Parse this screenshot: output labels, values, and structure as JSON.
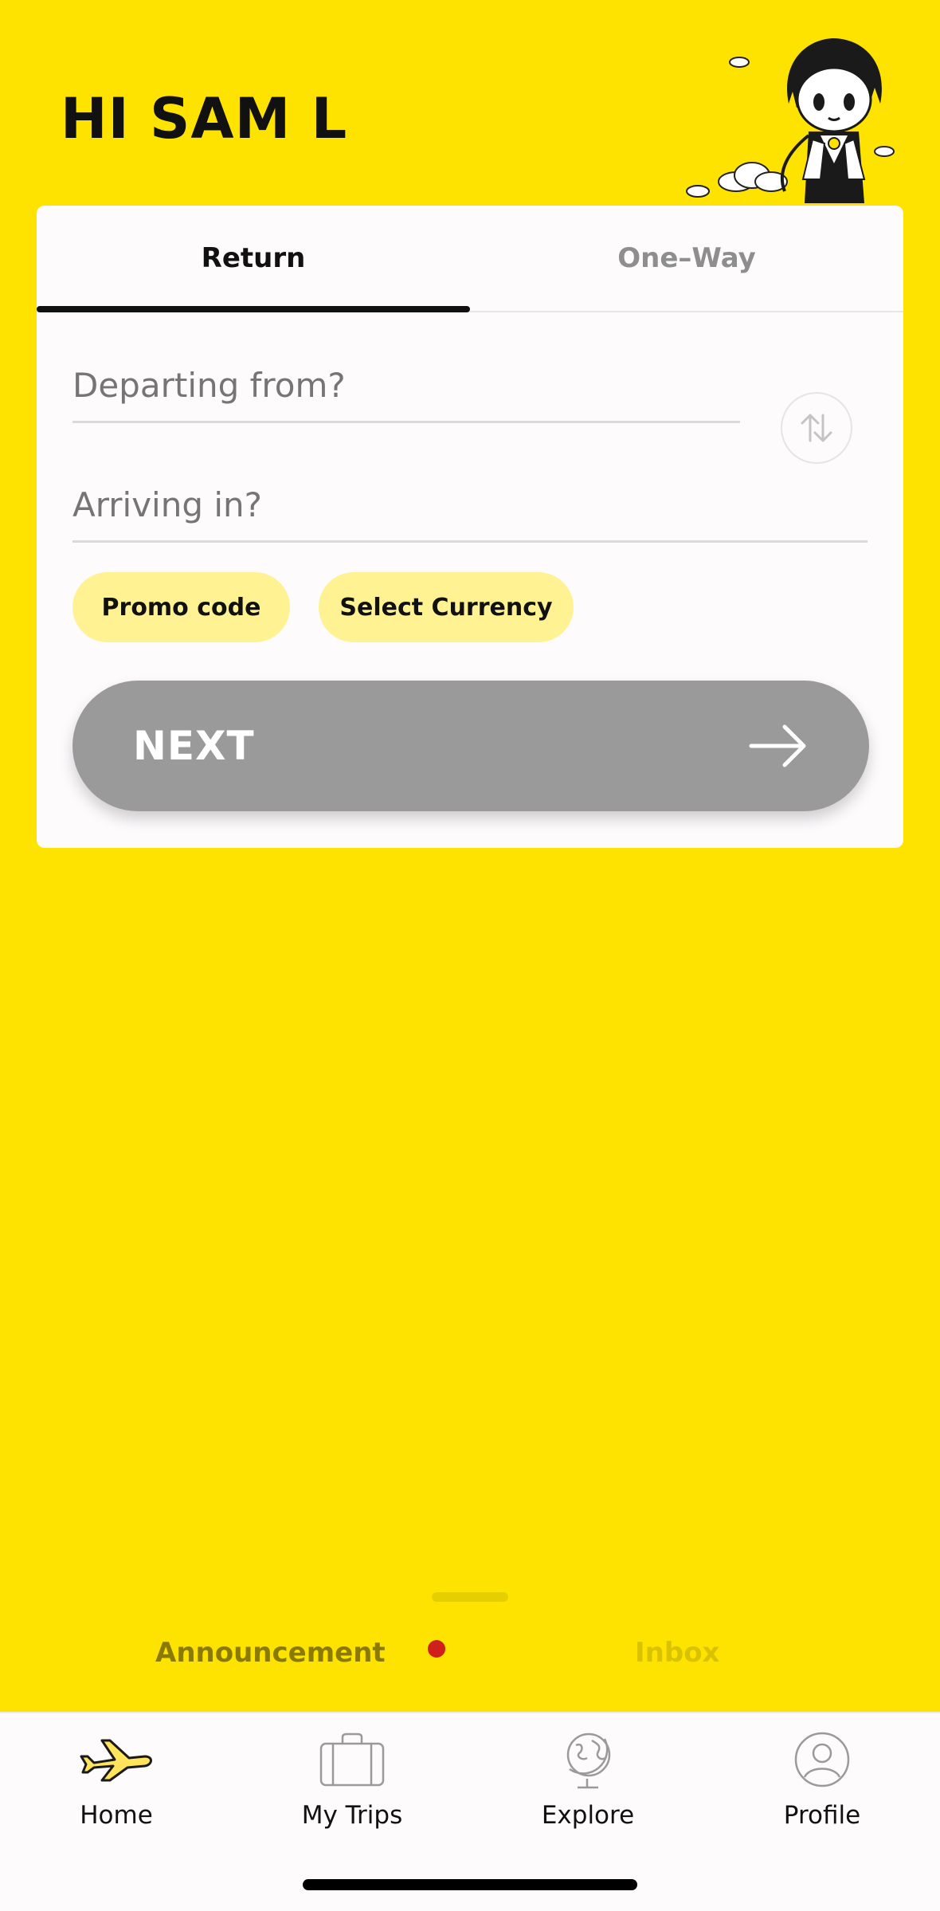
{
  "header": {
    "greeting": "HI SAM L"
  },
  "booking": {
    "tabs": [
      "Return",
      "One–Way"
    ],
    "active_tab": "Return",
    "departing_placeholder": "Departing from?",
    "arriving_placeholder": "Arriving in?",
    "promo_label": "Promo code",
    "currency_label": "Select Currency",
    "next_label": "NEXT"
  },
  "messages": {
    "announcement_label": "Announcement",
    "inbox_label": "Inbox"
  },
  "nav": {
    "home": "Home",
    "trips": "My Trips",
    "explore": "Explore",
    "profile": "Profile"
  },
  "colors": {
    "background": "#FFE300",
    "pill": "#FFF293",
    "next_disabled": "#9B9A9B",
    "notification_dot": "#D0201C"
  },
  "icons": [
    "swap-icon",
    "arrow-right-icon",
    "airplane-icon",
    "suitcase-icon",
    "globe-icon",
    "profile-icon"
  ]
}
